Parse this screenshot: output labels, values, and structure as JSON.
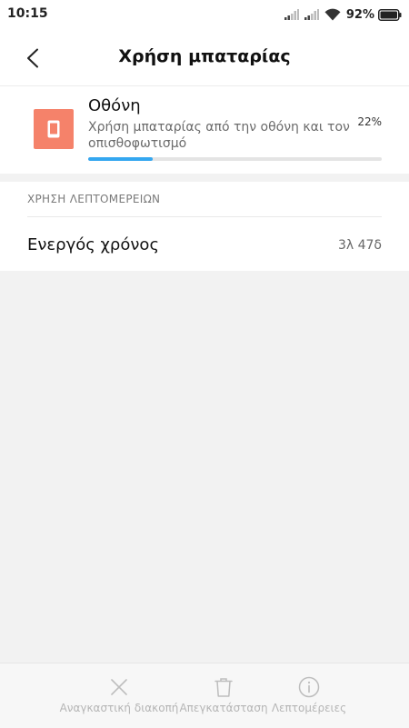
{
  "status_bar": {
    "time": "10:15",
    "battery_percent": "92%",
    "icons": [
      "signal-icon",
      "signal-icon",
      "wifi-icon",
      "battery-icon"
    ]
  },
  "header": {
    "title": "Χρήση μπαταρίας",
    "back_icon": "chevron-left-icon"
  },
  "item": {
    "icon": "screen-icon",
    "icon_color": "#f5826a",
    "title": "Οθόνη",
    "description": "Χρήση μπαταρίας από την οθόνη και τον οπισθοφωτισμό",
    "percent": "22%",
    "progress_fraction": 0.22,
    "progress_color": "#34a7f0"
  },
  "details": {
    "section_header": "ΧΡΗΣΗ ΛΕΠΤΟΜΕΡΕΙΩΝ",
    "rows": [
      {
        "label": "Ενεργός χρόνος",
        "value": "3λ 47δ"
      }
    ]
  },
  "bottom_bar": {
    "buttons": [
      {
        "label": "Αναγκαστική διακοπή",
        "icon": "close-icon"
      },
      {
        "label": "Απεγκατάσταση",
        "icon": "trash-icon"
      },
      {
        "label": "Λεπτομέρειες",
        "icon": "info-icon"
      }
    ]
  }
}
